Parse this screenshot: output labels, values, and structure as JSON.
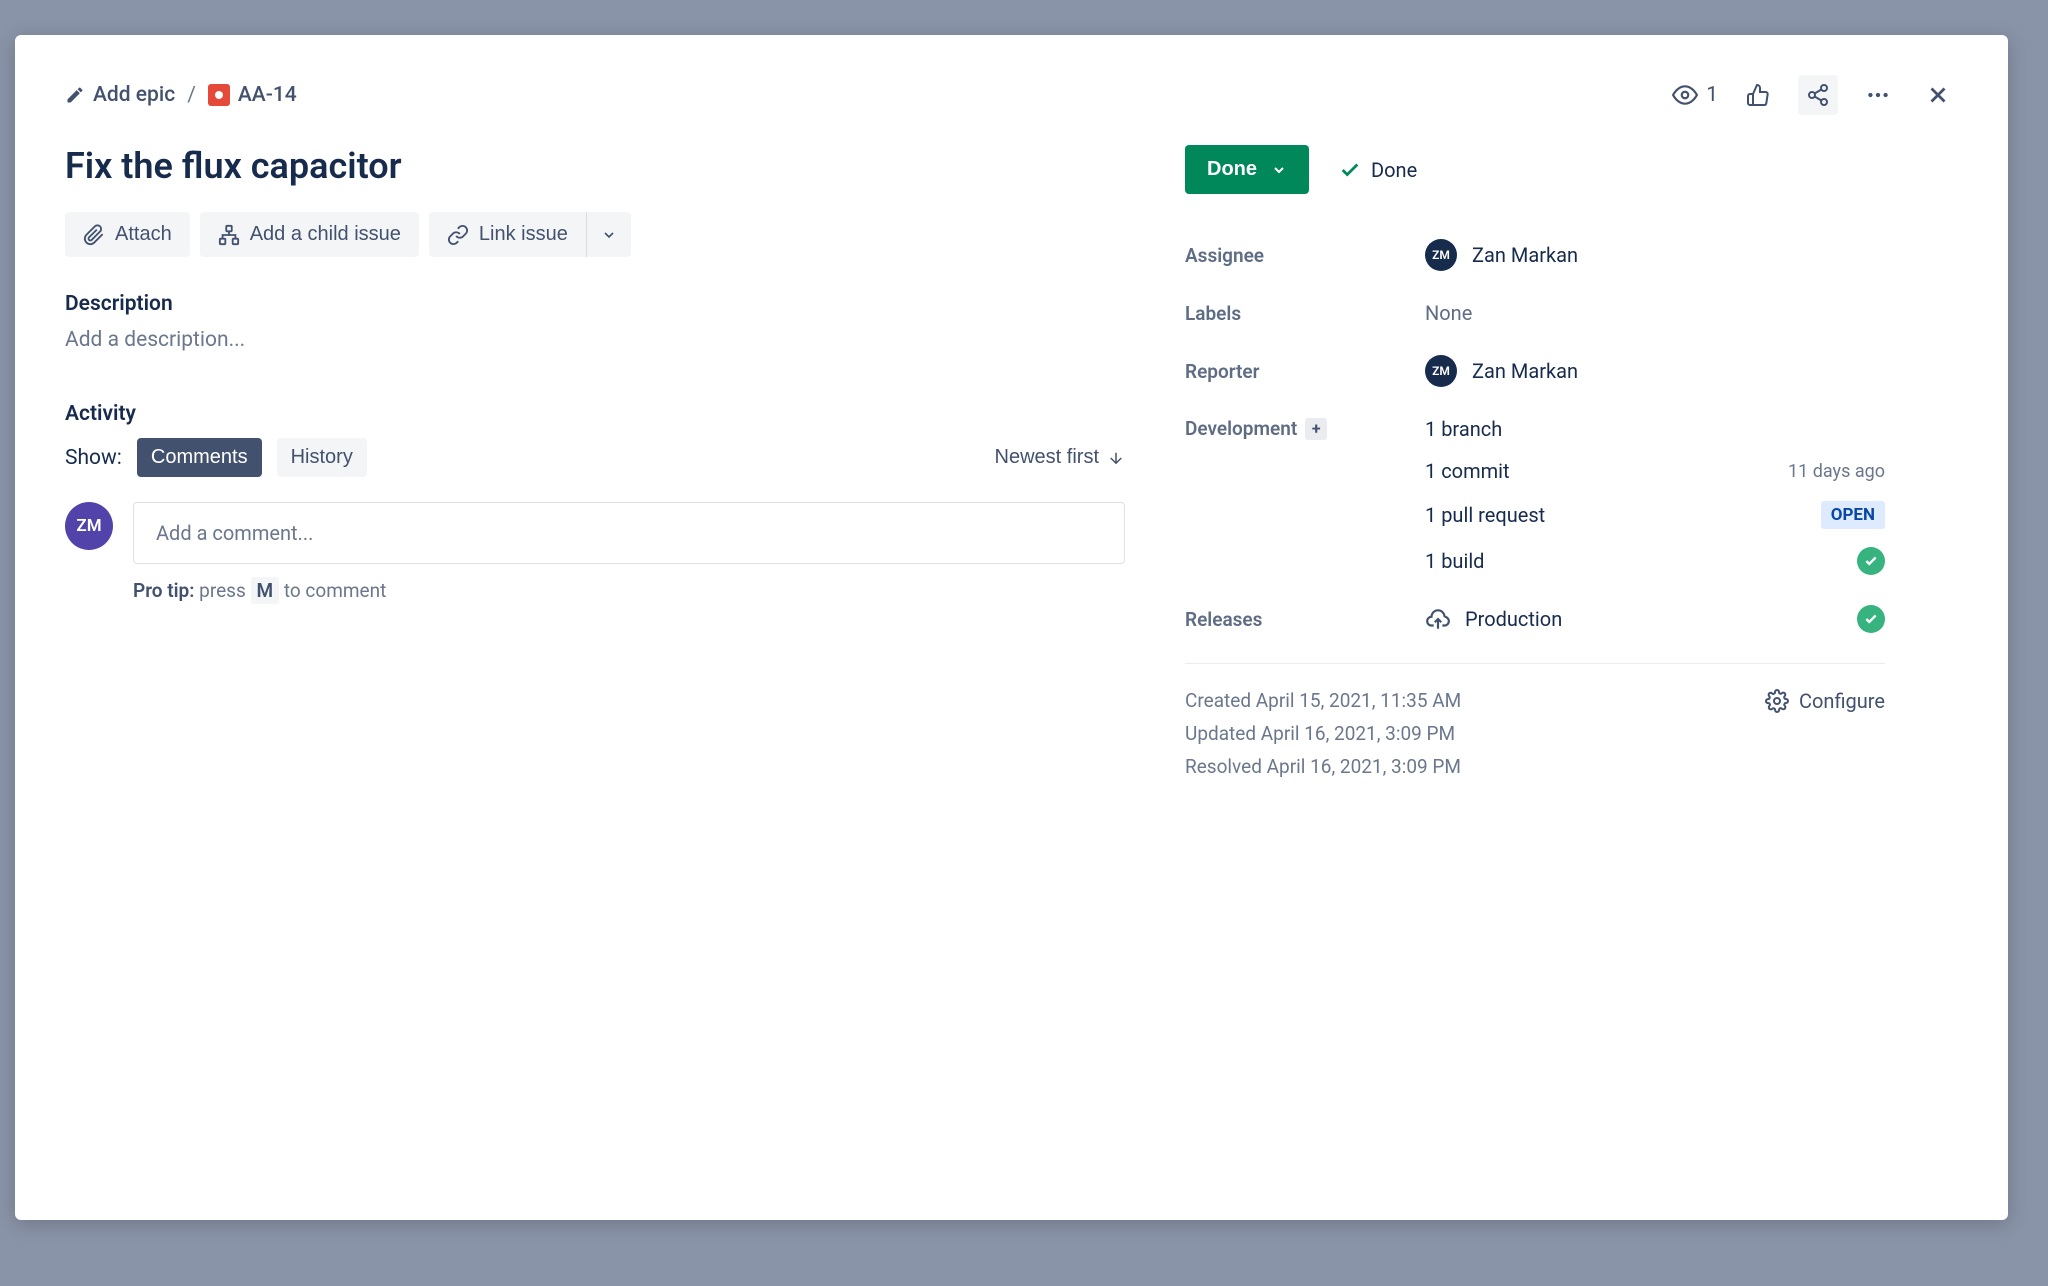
{
  "breadcrumb": {
    "add_epic": "Add epic",
    "separator": "/",
    "issue_key": "AA-14"
  },
  "header_actions": {
    "watch_count": "1"
  },
  "issue": {
    "title": "Fix the flux capacitor"
  },
  "actions": {
    "attach": "Attach",
    "add_child": "Add a child issue",
    "link_issue": "Link issue"
  },
  "description": {
    "label": "Description",
    "placeholder": "Add a description..."
  },
  "activity": {
    "label": "Activity",
    "show_label": "Show:",
    "tabs": {
      "comments": "Comments",
      "history": "History"
    },
    "sort": "Newest first",
    "comment_placeholder": "Add a comment...",
    "pro_tip_prefix": "Pro tip:",
    "pro_tip_text": "press",
    "pro_tip_key": "M",
    "pro_tip_suffix": "to comment",
    "avatar_initials": "ZM"
  },
  "status": {
    "button": "Done",
    "resolution": "Done"
  },
  "fields": {
    "assignee": {
      "label": "Assignee",
      "name": "Zan Markan",
      "initials": "ZM"
    },
    "labels": {
      "label": "Labels",
      "value": "None"
    },
    "reporter": {
      "label": "Reporter",
      "name": "Zan Markan",
      "initials": "ZM"
    },
    "development": {
      "label": "Development",
      "branch": "1 branch",
      "commit": "1 commit",
      "commit_time": "11 days ago",
      "pull_request": "1 pull request",
      "pr_status": "OPEN",
      "build": "1 build"
    },
    "releases": {
      "label": "Releases",
      "value": "Production"
    }
  },
  "footer": {
    "created": "Created April 15, 2021, 11:35 AM",
    "updated": "Updated April 16, 2021, 3:09 PM",
    "resolved": "Resolved April 16, 2021, 3:09 PM",
    "configure": "Configure"
  }
}
